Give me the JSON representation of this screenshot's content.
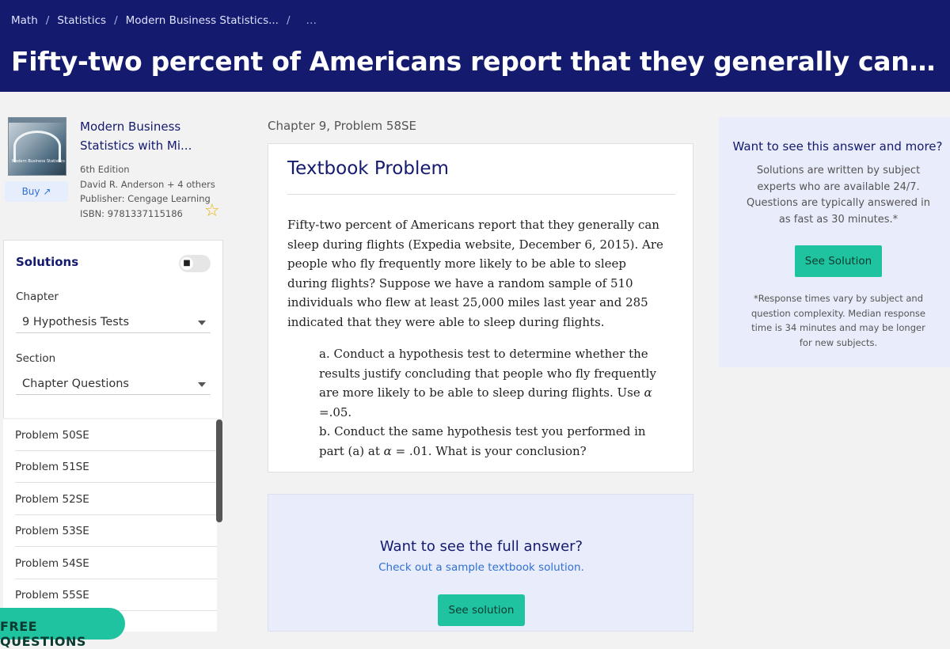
{
  "breadcrumb": [
    "Math",
    "Statistics",
    "Modern Business Statistics...",
    "Fifty-two percent of Americans report that they generally can sleep during flights (Expedia website, December 6, 2015). Are people who fl..."
  ],
  "page_title": "Fifty-two percent of Americans report that they generally can sleep during flights (Expe...",
  "book": {
    "title": "Modern Business Statistics with Mi...",
    "edition": "6th Edition",
    "authors": "David R. Anderson + 4 others",
    "publisher": "Publisher: Cengage Learning",
    "isbn": "ISBN: 9781337115186",
    "buy_label": "Buy",
    "cover_text": "Modern Business Statistics"
  },
  "sidebar": {
    "solutions_label": "Solutions",
    "chapter_label": "Chapter",
    "chapter_value": "9 Hypothesis Tests",
    "section_label": "Section",
    "section_value": "Chapter Questions",
    "problems": [
      "Problem 50SE",
      "Problem 51SE",
      "Problem 52SE",
      "Problem 53SE",
      "Problem 54SE",
      "Problem 55SE"
    ],
    "free_questions": "FREE QUESTIONS"
  },
  "main": {
    "chapter_heading": "Chapter 9, Problem 58SE",
    "card_title": "Textbook Problem",
    "problem_text": "Fifty-two percent of Americans report that they generally can sleep during flights (Expedia website, December 6, 2015). Are people who fly frequently more likely to be able to sleep during flights? Suppose we have a random sample of 510 individuals who flew at least 25,000 miles last year and 285 indicated that they were able to sleep during flights.",
    "part_a_pre": "a. Conduct a hypothesis test to determine whether the results justify concluding that people who fly frequently are more likely to be able to sleep during flights. Use ",
    "part_a_alpha": "α",
    "part_a_post": " =.05.",
    "part_b_pre": "b. Conduct the same hypothesis test you performed in part (a) at ",
    "part_b_alpha": "α",
    "part_b_post": " = .01. What is your conclusion?"
  },
  "answer_card": {
    "title": "Want to see the full answer?",
    "subtitle": "Check out a sample textbook solution.",
    "button": "See solution"
  },
  "side": {
    "title": "Want to see this answer and more?",
    "text": "Solutions are written by subject experts who are available 24/7. Questions are typically answered in as fast as 30 minutes.*",
    "button": "See Solution",
    "note": "*Response times vary by subject and question complexity. Median response time is 34 minutes and may be longer for new subjects."
  },
  "colors": {
    "navy": "#141a6e",
    "teal": "#1fc3a0",
    "link": "#2f6fd6",
    "panel": "#e9ecfa"
  }
}
